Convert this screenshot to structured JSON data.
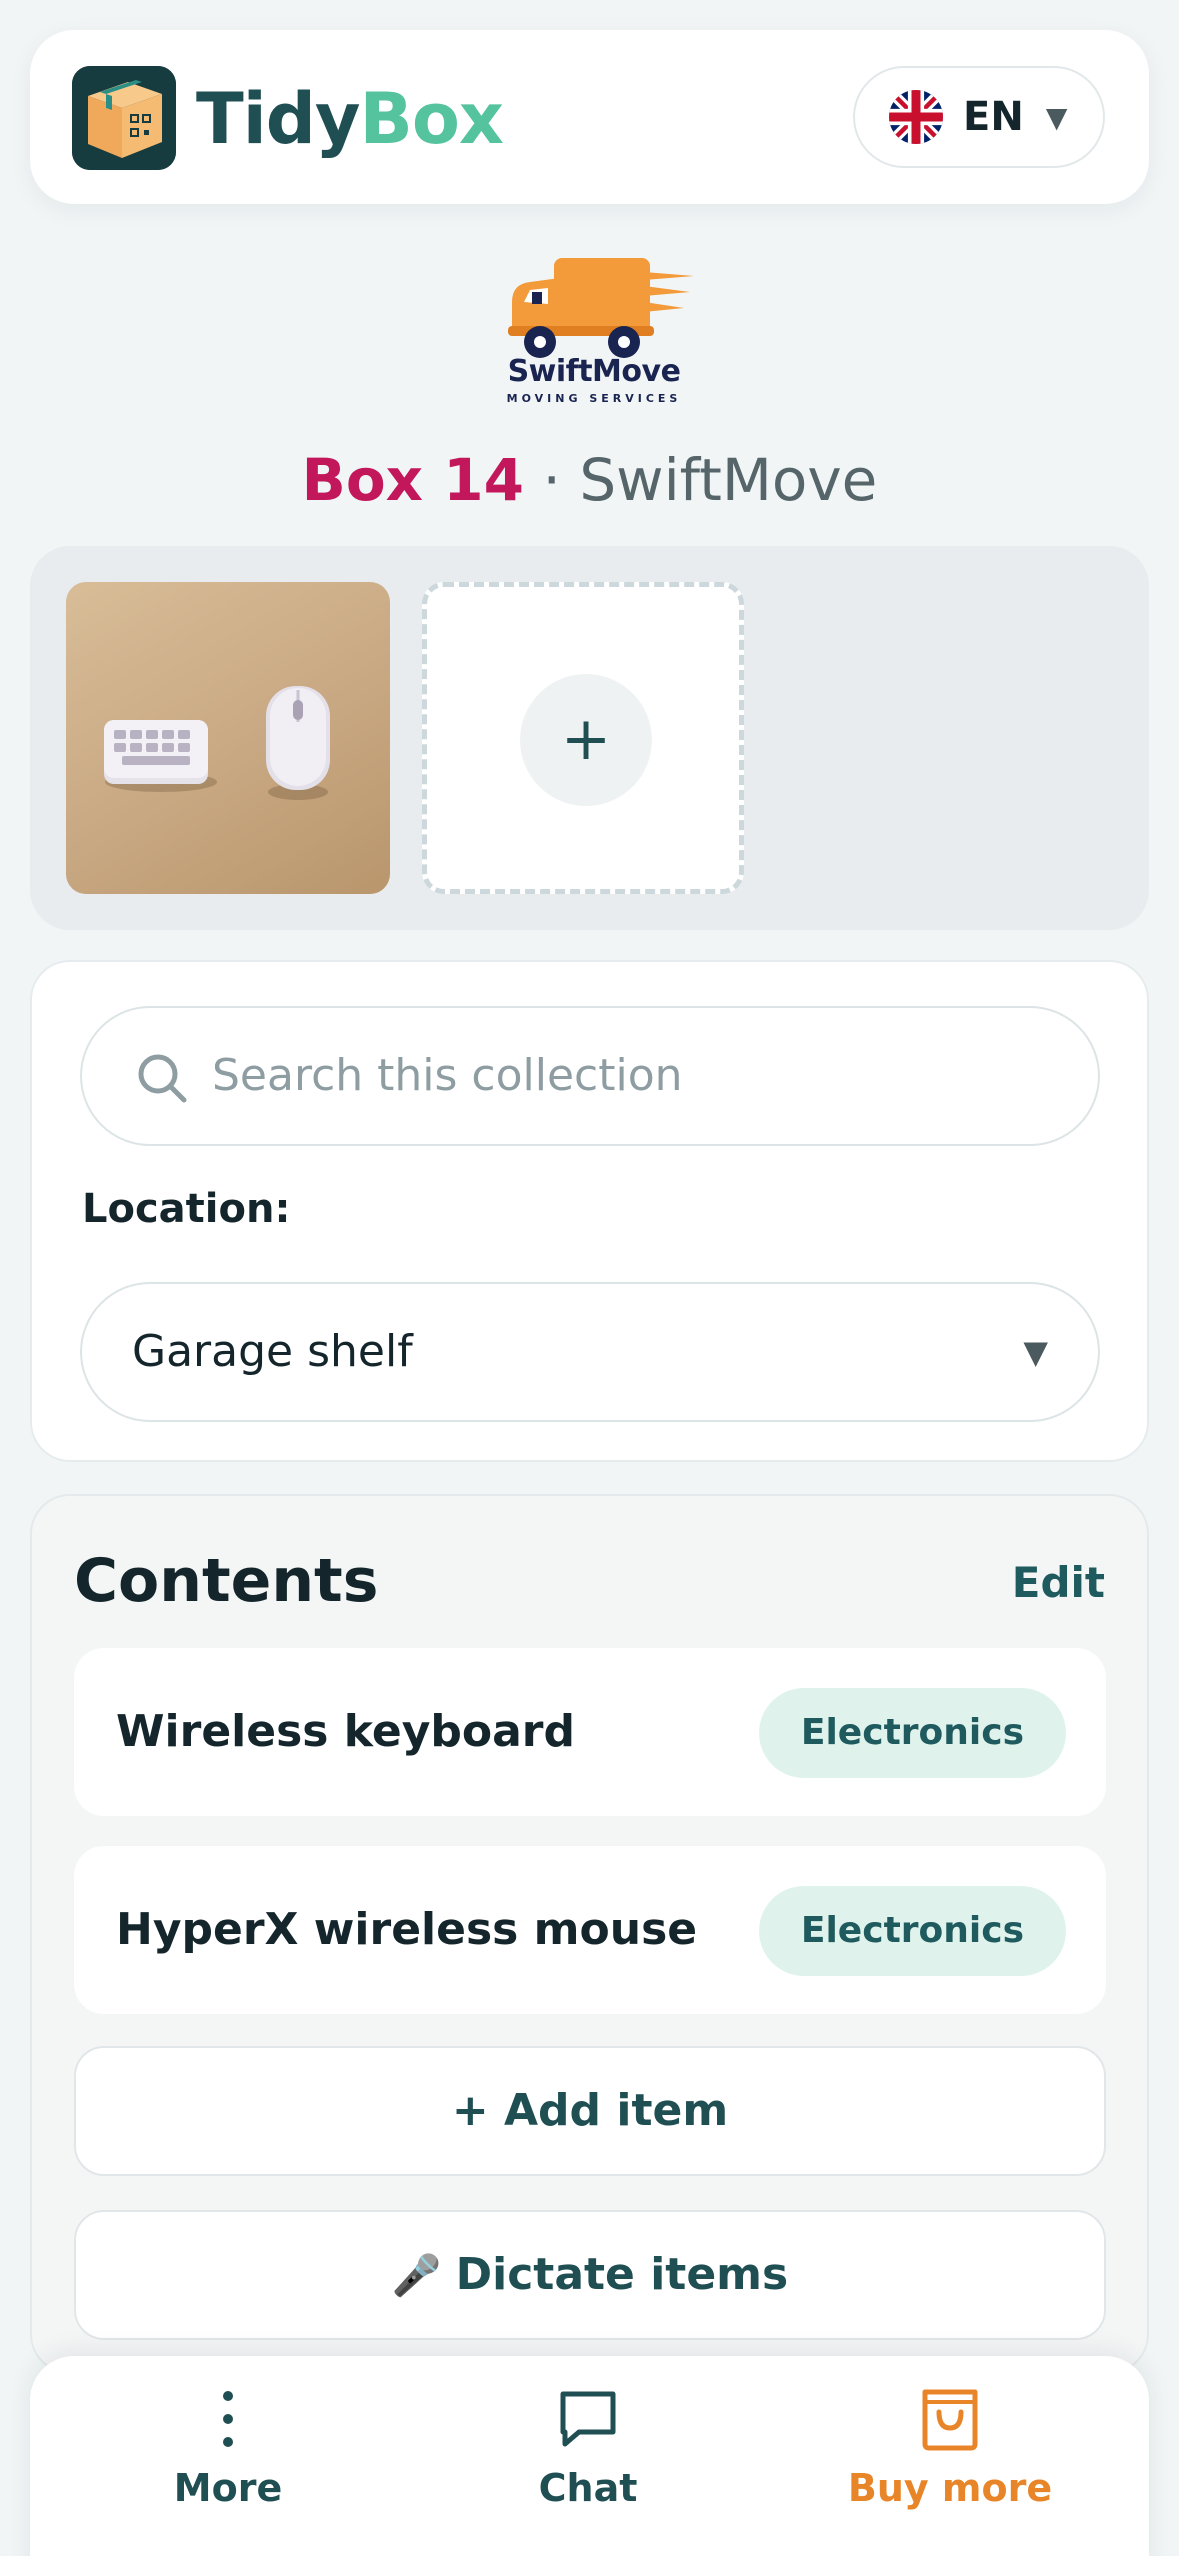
{
  "header": {
    "brand_part1": "Tidy",
    "brand_part2": "Box",
    "language": {
      "code": "EN",
      "flag": "uk-flag-icon"
    }
  },
  "partner": {
    "name": "SwiftMove",
    "tagline": "MOVING SERVICES"
  },
  "box": {
    "label": "Box 14",
    "separator": "·",
    "collection": "SwiftMove"
  },
  "photos": {
    "add_label": "+"
  },
  "search": {
    "placeholder": "Search this collection"
  },
  "location": {
    "label": "Location:",
    "value": "Garage shelf"
  },
  "contents": {
    "title": "Contents",
    "edit_label": "Edit",
    "items": [
      {
        "name": "Wireless keyboard",
        "category": "Electronics"
      },
      {
        "name": "HyperX wireless mouse",
        "category": "Electronics"
      }
    ],
    "add_item_label": "+ Add item",
    "dictate_label": "Dictate items"
  },
  "nav": {
    "more": "More",
    "chat": "Chat",
    "buy_more": "Buy more"
  },
  "colors": {
    "brand_dark": "#1f4f53",
    "brand_green": "#55c39d",
    "box_number": "#c2185b",
    "accent_orange": "#e88528",
    "tag_bg": "#dff3ec"
  }
}
